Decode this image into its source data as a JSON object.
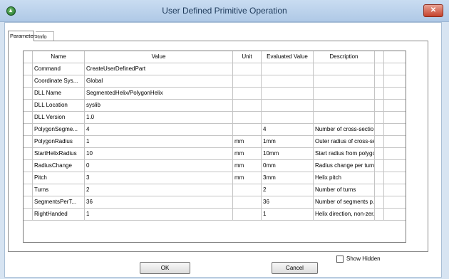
{
  "window": {
    "title": "User Defined Primitive Operation",
    "close_symbol": "✕",
    "app_icon": "ansys-triangle-icon"
  },
  "tabs": [
    {
      "label": "Parameters",
      "active": true
    },
    {
      "label": "Info",
      "active": false
    }
  ],
  "table": {
    "columns": [
      "Name",
      "Value",
      "Unit",
      "Evaluated Value",
      "Description"
    ],
    "rows": [
      {
        "name": "Command",
        "value": "CreateUserDefinedPart",
        "unit": "",
        "evaluated": "",
        "description": ""
      },
      {
        "name": "Coordinate Sys...",
        "value": "Global",
        "unit": "",
        "evaluated": "",
        "description": ""
      },
      {
        "name": "DLL Name",
        "value": "SegmentedHelix/PolygonHelix",
        "unit": "",
        "evaluated": "",
        "description": ""
      },
      {
        "name": "DLL Location",
        "value": "syslib",
        "unit": "",
        "evaluated": "",
        "description": ""
      },
      {
        "name": "DLL Version",
        "value": "1.0",
        "unit": "",
        "evaluated": "",
        "description": ""
      },
      {
        "name": "PolygonSegme...",
        "value": "4",
        "unit": "",
        "evaluated": "4",
        "description": "Number of cross-sectio..."
      },
      {
        "name": "PolygonRadius",
        "value": "1",
        "unit": "mm",
        "evaluated": "1mm",
        "description": "Outer radius of cross-se..."
      },
      {
        "name": "StartHelixRadius",
        "value": "10",
        "unit": "mm",
        "evaluated": "10mm",
        "description": "Start radius from polygo..."
      },
      {
        "name": "RadiusChange",
        "value": "0",
        "unit": "mm",
        "evaluated": "0mm",
        "description": "Radius change per turn"
      },
      {
        "name": "Pitch",
        "value": "3",
        "unit": "mm",
        "evaluated": "3mm",
        "description": "Helix pitch"
      },
      {
        "name": "Turns",
        "value": "2",
        "unit": "",
        "evaluated": "2",
        "description": "Number of turns"
      },
      {
        "name": "SegmentsPerT...",
        "value": "36",
        "unit": "",
        "evaluated": "36",
        "description": "Number of segments p..."
      },
      {
        "name": "RightHanded",
        "value": "1",
        "unit": "",
        "evaluated": "1",
        "description": "Helix direction, non-zer..."
      }
    ]
  },
  "show_hidden": {
    "label": "Show Hidden",
    "checked": false
  },
  "buttons": {
    "ok": "OK",
    "cancel": "Cancel"
  }
}
